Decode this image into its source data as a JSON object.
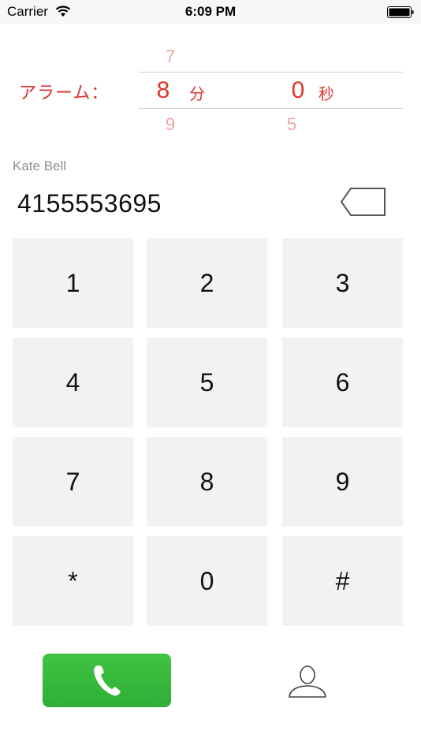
{
  "status_bar": {
    "carrier": "Carrier",
    "time": "6:09 PM",
    "wifi_icon": "wifi-icon",
    "battery_icon": "battery-full-icon"
  },
  "alarm": {
    "label": "アラーム：",
    "minutes": {
      "above": "7",
      "selected": "8",
      "below": "9",
      "unit": "分"
    },
    "seconds": {
      "above": "",
      "selected": "0",
      "below": "5",
      "unit": "秒"
    },
    "accent_color": "#e0342a",
    "dim_color": "#f0a5a1"
  },
  "contact": {
    "name": "Kate Bell",
    "number": "4155553695",
    "backspace_icon": "backspace-icon"
  },
  "keypad": {
    "keys": [
      "1",
      "2",
      "3",
      "4",
      "5",
      "6",
      "7",
      "8",
      "9",
      "*",
      "0",
      "#"
    ],
    "key_background": "#f2f2f2"
  },
  "actions": {
    "call_icon": "phone-icon",
    "call_color": "#34b83a",
    "contacts_icon": "person-icon"
  }
}
